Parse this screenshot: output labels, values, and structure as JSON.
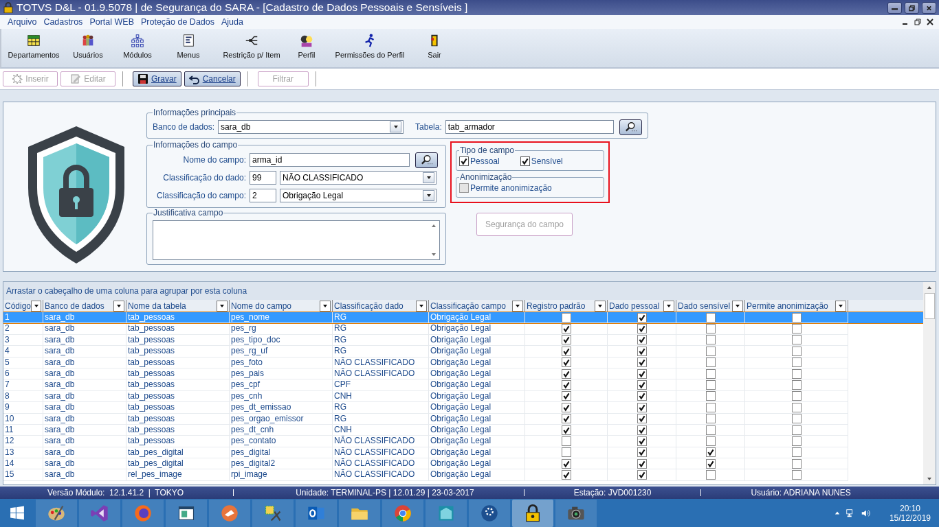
{
  "window": {
    "title": "TOTVS D&L - 01.9.5078 | de Segurança do SARA - [Cadastro de Dados Pessoais e Sensíveis ]"
  },
  "menu": [
    "Arquivo",
    "Cadastros",
    "Portal WEB",
    "Proteção de Dados",
    "Ajuda"
  ],
  "toolbar": [
    "Departamentos",
    "Usuários",
    "Módulos",
    "Menus",
    "Restrição p/ Item",
    "Perfil",
    "Permissões do Perfil",
    "Sair"
  ],
  "actions": [
    {
      "label": "Inserir",
      "disabled": true
    },
    {
      "label": "Editar",
      "disabled": true
    },
    {
      "label": "Gravar",
      "disabled": false
    },
    {
      "label": "Cancelar",
      "disabled": false
    },
    {
      "label": "Filtrar",
      "disabled": true
    }
  ],
  "main_info": {
    "legend": "Informações principais",
    "db_label": "Banco de dados:",
    "db_value": "sara_db",
    "table_label": "Tabela:",
    "table_value": "tab_armador"
  },
  "field_info": {
    "legend": "Informações do campo",
    "name_label": "Nome do campo:",
    "name_value": "arma_id",
    "data_class_label": "Classificação do dado:",
    "data_class_code": "99",
    "data_class_value": "NÃO CLASSIFICADO",
    "field_class_label": "Classificação do campo:",
    "field_class_code": "2",
    "field_class_value": "Obrigação Legal"
  },
  "justification": {
    "legend": "Justificativa campo"
  },
  "field_type": {
    "legend": "Tipo de campo",
    "options": [
      {
        "label": "Pessoal",
        "checked": true
      },
      {
        "label": "Sensível",
        "checked": true
      }
    ]
  },
  "anonymization": {
    "legend": "Anonimização",
    "label": "Permite anonimização",
    "checked": false
  },
  "security_button": {
    "label": "Segurança do campo",
    "disabled": true
  },
  "grid": {
    "group_hint": "Arrastar o cabeçalho de uma coluna para agrupar por esta coluna",
    "columns": [
      "Código",
      "Banco de dados",
      "Nome da tabela",
      "Nome do campo",
      "Classificação dado",
      "Classificação campo",
      "Registro padrão",
      "Dado pessoal",
      "Dado sensível",
      "Permite anonimização"
    ],
    "rows": [
      {
        "selected": true,
        "cells": [
          "1",
          "sara_db",
          "tab_pessoas",
          "pes_nome",
          "RG",
          "Obrigação Legal"
        ],
        "checks": [
          false,
          true,
          false,
          false
        ]
      },
      {
        "selected": false,
        "cells": [
          "2",
          "sara_db",
          "tab_pessoas",
          "pes_rg",
          "RG",
          "Obrigação Legal"
        ],
        "checks": [
          true,
          true,
          false,
          false
        ]
      },
      {
        "selected": false,
        "cells": [
          "3",
          "sara_db",
          "tab_pessoas",
          "pes_tipo_doc",
          "RG",
          "Obrigação Legal"
        ],
        "checks": [
          true,
          true,
          false,
          false
        ]
      },
      {
        "selected": false,
        "cells": [
          "4",
          "sara_db",
          "tab_pessoas",
          "pes_rg_uf",
          "RG",
          "Obrigação Legal"
        ],
        "checks": [
          true,
          true,
          false,
          false
        ]
      },
      {
        "selected": false,
        "cells": [
          "5",
          "sara_db",
          "tab_pessoas",
          "pes_foto",
          "NÃO CLASSIFICADO",
          "Obrigação Legal"
        ],
        "checks": [
          true,
          true,
          false,
          false
        ]
      },
      {
        "selected": false,
        "cells": [
          "6",
          "sara_db",
          "tab_pessoas",
          "pes_pais",
          "NÃO CLASSIFICADO",
          "Obrigação Legal"
        ],
        "checks": [
          true,
          true,
          false,
          false
        ]
      },
      {
        "selected": false,
        "cells": [
          "7",
          "sara_db",
          "tab_pessoas",
          "pes_cpf",
          "CPF",
          "Obrigação Legal"
        ],
        "checks": [
          true,
          true,
          false,
          false
        ]
      },
      {
        "selected": false,
        "cells": [
          "8",
          "sara_db",
          "tab_pessoas",
          "pes_cnh",
          "CNH",
          "Obrigação Legal"
        ],
        "checks": [
          true,
          true,
          false,
          false
        ]
      },
      {
        "selected": false,
        "cells": [
          "9",
          "sara_db",
          "tab_pessoas",
          "pes_dt_emissao",
          "RG",
          "Obrigação Legal"
        ],
        "checks": [
          true,
          true,
          false,
          false
        ]
      },
      {
        "selected": false,
        "cells": [
          "10",
          "sara_db",
          "tab_pessoas",
          "pes_orgao_emissor",
          "RG",
          "Obrigação Legal"
        ],
        "checks": [
          true,
          true,
          false,
          false
        ]
      },
      {
        "selected": false,
        "cells": [
          "11",
          "sara_db",
          "tab_pessoas",
          "pes_dt_cnh",
          "CNH",
          "Obrigação Legal"
        ],
        "checks": [
          true,
          true,
          false,
          false
        ]
      },
      {
        "selected": false,
        "cells": [
          "12",
          "sara_db",
          "tab_pessoas",
          "pes_contato",
          "NÃO CLASSIFICADO",
          "Obrigação Legal"
        ],
        "checks": [
          false,
          true,
          false,
          false
        ]
      },
      {
        "selected": false,
        "cells": [
          "13",
          "sara_db",
          "tab_pes_digital",
          "pes_digital",
          "NÃO CLASSIFICADO",
          "Obrigação Legal"
        ],
        "checks": [
          false,
          true,
          true,
          false
        ]
      },
      {
        "selected": false,
        "cells": [
          "14",
          "sara_db",
          "tab_pes_digital",
          "pes_digital2",
          "NÃO CLASSIFICADO",
          "Obrigação Legal"
        ],
        "checks": [
          true,
          true,
          true,
          false
        ]
      },
      {
        "selected": false,
        "cells": [
          "15",
          "sara_db",
          "rel_pes_image",
          "rpi_image",
          "NÃO CLASSIFICADO",
          "Obrigação Legal"
        ],
        "checks": [
          true,
          true,
          false,
          false
        ]
      }
    ]
  },
  "status_bar": [
    "Versão Módulo:  12.1.41.2  |  TOKYO",
    "Unidade: TERMINAL-PS | 12.01.29 | 23-03-2017",
    "Estação: JVD001230",
    "Usuário: ADRIANA NUNES"
  ],
  "taskbar": {
    "apps": [
      {
        "kind": "paint",
        "active": false
      },
      {
        "kind": "studio",
        "active": false
      },
      {
        "kind": "firefox",
        "active": false
      },
      {
        "kind": "window",
        "active": false
      },
      {
        "kind": "orange",
        "active": false
      },
      {
        "kind": "tool",
        "active": false
      },
      {
        "kind": "outlook",
        "active": false
      },
      {
        "kind": "folder",
        "active": false
      },
      {
        "kind": "chrome",
        "active": false
      },
      {
        "kind": "building",
        "active": false
      },
      {
        "kind": "bluecircle",
        "active": false
      },
      {
        "kind": "lock",
        "active": true
      },
      {
        "kind": "camera",
        "active": false
      }
    ],
    "time": "20:10",
    "date": "15/12/2019"
  }
}
